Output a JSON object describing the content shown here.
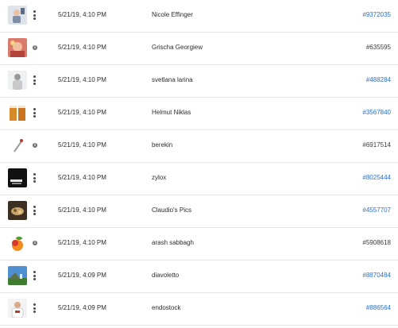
{
  "colors": {
    "link": "#2d6ec9",
    "text": "#2c2c2c",
    "divider": "#e6e6e6"
  },
  "rows": [
    {
      "thumb": "toddler-photo",
      "badge": "more",
      "date": "5/21/19, 4:10 PM",
      "user": "Nicole Effinger",
      "order": "#9372035",
      "order_link": true
    },
    {
      "thumb": "portrait-photo",
      "badge": "info",
      "date": "5/21/19, 4:10 PM",
      "user": "Grischa Georgiew",
      "order": "#635595",
      "order_link": false
    },
    {
      "thumb": "person-photo",
      "badge": "more",
      "date": "5/21/19, 4:10 PM",
      "user": "svetlana larina",
      "order": "#488284",
      "order_link": true
    },
    {
      "thumb": "beer-glasses-photo",
      "badge": "more",
      "date": "5/21/19, 4:10 PM",
      "user": "Helmut Niklas",
      "order": "#3567840",
      "order_link": true
    },
    {
      "thumb": "spoon-photo",
      "badge": "info",
      "date": "5/21/19, 4:10 PM",
      "user": "berekin",
      "order": "#6917514",
      "order_link": false
    },
    {
      "thumb": "dark-object-photo",
      "badge": "more",
      "date": "5/21/19, 4:10 PM",
      "user": "zylox",
      "order": "#8025444",
      "order_link": true
    },
    {
      "thumb": "food-photo",
      "badge": "more",
      "date": "5/21/19, 4:10 PM",
      "user": "Claudio's Pics",
      "order": "#4557707",
      "order_link": true
    },
    {
      "thumb": "fruit-photo",
      "badge": "info",
      "date": "5/21/19, 4:10 PM",
      "user": "arash sabbagh",
      "order": "#5908618",
      "order_link": false
    },
    {
      "thumb": "landscape-photo",
      "badge": "more",
      "date": "5/21/19, 4:09 PM",
      "user": "diavoletto",
      "order": "#8870484",
      "order_link": true
    },
    {
      "thumb": "chef-photo",
      "badge": "more",
      "date": "5/21/19, 4:09 PM",
      "user": "endostock",
      "order": "#886564",
      "order_link": true
    }
  ]
}
